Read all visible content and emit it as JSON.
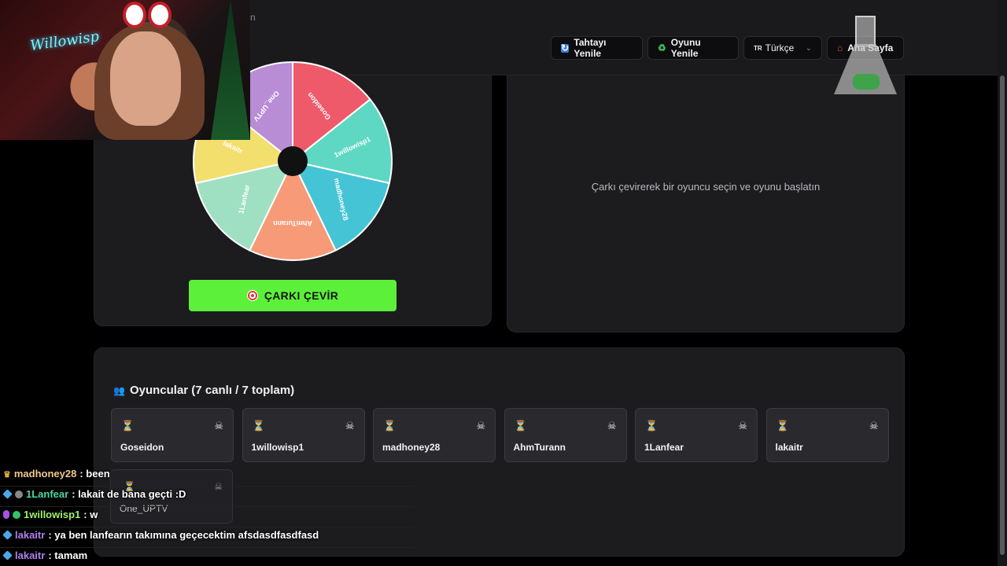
{
  "header": {
    "subtitle": "n",
    "buttons": {
      "refresh_board": "Tahtayı Yenile",
      "refresh_game": "Oyunu Yenile",
      "language": "Türkçe",
      "language_flag": "TR",
      "home": "Ana Sayfa"
    }
  },
  "wheel": {
    "segments": [
      {
        "name": "Goseidon",
        "color": "#ef5a6a"
      },
      {
        "name": "1willowisp1",
        "color": "#5ed8c2"
      },
      {
        "name": "madhoney28",
        "color": "#45c4d6"
      },
      {
        "name": "AhmTurann",
        "color": "#f79a78"
      },
      {
        "name": "1Lanfear",
        "color": "#9fe0c2"
      },
      {
        "name": "lakaitr",
        "color": "#f2df6e"
      },
      {
        "name": "One_UPTV",
        "color": "#b98cd6"
      }
    ],
    "spin_button": "ÇARKI ÇEVİR"
  },
  "game": {
    "message": "Çarkı çevirerek bir oyuncu seçin ve oyunu başlatın"
  },
  "players": {
    "title": "Oyuncular (7 canlı / 7 toplam)",
    "list": [
      "Goseidon",
      "1willowisp1",
      "madhoney28",
      "AhmTurann",
      "1Lanfear",
      "lakaitr",
      "One_UPTV"
    ]
  },
  "overlay": {
    "neon_sign": "Willowisp",
    "chat": [
      {
        "user": "madhoney28",
        "color": "#f0c98a",
        "text": ": been"
      },
      {
        "user": "1Lanfear",
        "color": "#4ad8a0",
        "text": ": lakait de bana geçti :D"
      },
      {
        "user": "1willowisp1",
        "color": "#9ef06a",
        "text": ": w"
      },
      {
        "user": "lakaitr",
        "color": "#b080f0",
        "text": ": ya ben lanfearın takımına geçecektim afsdasdfasdfasd"
      },
      {
        "user": "lakaitr",
        "color": "#b080f0",
        "text": ": tamam"
      }
    ]
  }
}
